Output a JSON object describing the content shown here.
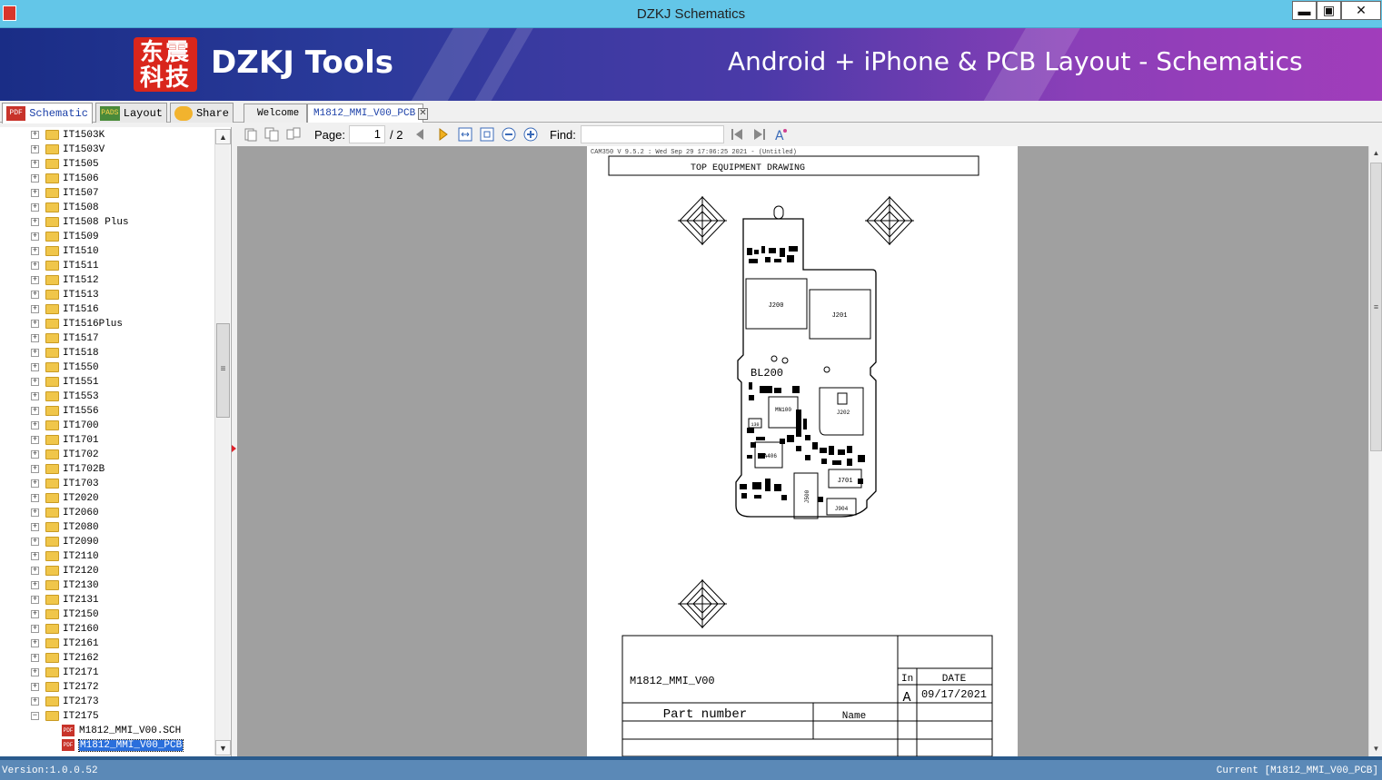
{
  "window": {
    "title": "DZKJ Schematics",
    "min": "▬",
    "max": "▣",
    "close": "✕"
  },
  "banner": {
    "logo": "东震\n科技",
    "brand": "DZKJ Tools",
    "tagline": "Android + iPhone & PCB Layout - Schematics"
  },
  "nav_tabs": [
    {
      "icon": "PDF",
      "label": "Schematic",
      "active": true
    },
    {
      "icon": "PADS",
      "label": "Layout",
      "active": false
    },
    {
      "icon": "cloud-share",
      "label": "Share",
      "active": false
    }
  ],
  "doc_tabs": [
    {
      "label": "Welcome",
      "active": false
    },
    {
      "label": "M1812_MMI_V00_PCB",
      "active": true,
      "close": "✕"
    }
  ],
  "toolbar": {
    "page_label": "Page:",
    "page_value": "1",
    "page_total": "/ 2",
    "find_label": "Find:",
    "find_value": ""
  },
  "tree": {
    "folders": [
      "IT1503K",
      "IT1503V",
      "IT1505",
      "IT1506",
      "IT1507",
      "IT1508",
      "IT1508 Plus",
      "IT1509",
      "IT1510",
      "IT1511",
      "IT1512",
      "IT1513",
      "IT1516",
      "IT1516Plus",
      "IT1517",
      "IT1518",
      "IT1550",
      "IT1551",
      "IT1553",
      "IT1556",
      "IT1700",
      "IT1701",
      "IT1702",
      "IT1702B",
      "IT1703",
      "IT2020",
      "IT2060",
      "IT2080",
      "IT2090",
      "IT2110",
      "IT2120",
      "IT2130",
      "IT2131",
      "IT2150",
      "IT2160",
      "IT2161",
      "IT2162",
      "IT2171",
      "IT2172",
      "IT2173"
    ],
    "expanded_folder": "IT2175",
    "files": [
      {
        "label": "M1812_MMI_V00.SCH",
        "selected": false
      },
      {
        "label": "M1812_MMI_V00_PCB",
        "selected": true
      }
    ]
  },
  "document": {
    "header": "CAM350 V 9.5.2 : Wed Sep 29 17:06:25 2021 - (Untitled)",
    "title": "TOP EQUIPMENT DRAWING",
    "board_labels": {
      "j200": "J200",
      "j201": "J201",
      "bl200": "BL200",
      "mn100": "MN100",
      "j202": "J202",
      "ma406": "MA406",
      "j701": "J701",
      "j500": "J500",
      "j904": "J904",
      "c130": "130"
    },
    "title_block": {
      "model": "M1812_MMI_V00",
      "in_label": "In",
      "date_label": "DATE",
      "rev": "A",
      "date": "09/17/2021",
      "part_number_label": "Part number",
      "name_label": "Name"
    }
  },
  "status": {
    "version": "Version:1.0.0.52",
    "current": "Current [M1812_MMI_V00_PCB]"
  }
}
